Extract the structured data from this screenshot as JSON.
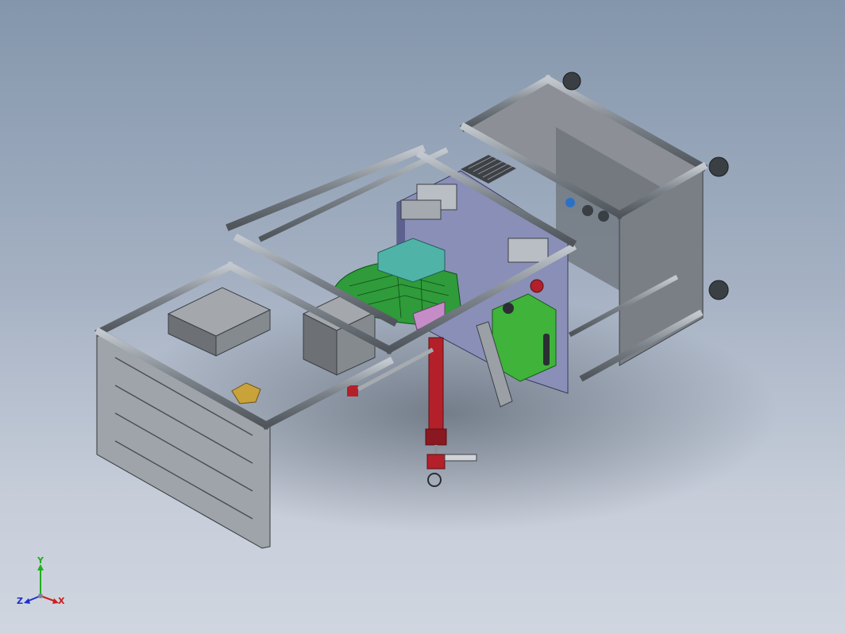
{
  "viewport": {
    "background_top": "#8496ac",
    "background_bottom": "#d0d6e0"
  },
  "model": {
    "frame_color": "#6f767c",
    "frame_highlight": "#b3bac1",
    "panel_color": "#8e9399",
    "plate_color": "#8a8fb8",
    "green_part_color": "#2f9b3a",
    "teal_part_color": "#4fb3a8",
    "red_part_color": "#b3202a",
    "gold_part_color": "#c9a23a",
    "pink_part_color": "#c58cc8",
    "blue_part_color": "#2b72c5"
  },
  "triad": {
    "y_label": "Y",
    "x_label": "X",
    "z_label": "Z",
    "y_color": "#1fae1f",
    "x_color": "#d11c1c",
    "z_color": "#1c2fd1"
  }
}
